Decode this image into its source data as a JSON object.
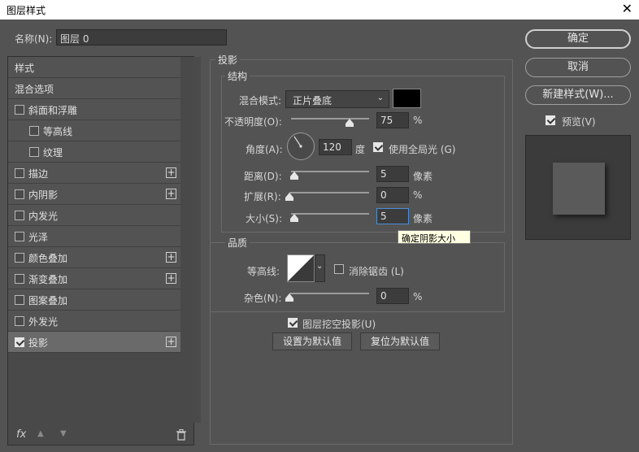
{
  "window": {
    "title": "图层样式",
    "close": "✕"
  },
  "name_field": {
    "label": "名称(N):",
    "value": "图层 0"
  },
  "style_list": {
    "items": [
      {
        "label": "样式",
        "checkbox": false,
        "checked": false,
        "plus": false,
        "indent": 0
      },
      {
        "label": "混合选项",
        "checkbox": false,
        "checked": false,
        "plus": false,
        "indent": 0
      },
      {
        "label": "斜面和浮雕",
        "checkbox": true,
        "checked": false,
        "plus": false,
        "indent": 0
      },
      {
        "label": "等高线",
        "checkbox": true,
        "checked": false,
        "plus": false,
        "indent": 1
      },
      {
        "label": "纹理",
        "checkbox": true,
        "checked": false,
        "plus": false,
        "indent": 1
      },
      {
        "label": "描边",
        "checkbox": true,
        "checked": false,
        "plus": true,
        "indent": 0
      },
      {
        "label": "内阴影",
        "checkbox": true,
        "checked": false,
        "plus": true,
        "indent": 0
      },
      {
        "label": "内发光",
        "checkbox": true,
        "checked": false,
        "plus": false,
        "indent": 0
      },
      {
        "label": "光泽",
        "checkbox": true,
        "checked": false,
        "plus": false,
        "indent": 0
      },
      {
        "label": "颜色叠加",
        "checkbox": true,
        "checked": false,
        "plus": true,
        "indent": 0
      },
      {
        "label": "渐变叠加",
        "checkbox": true,
        "checked": false,
        "plus": true,
        "indent": 0
      },
      {
        "label": "图案叠加",
        "checkbox": true,
        "checked": false,
        "plus": false,
        "indent": 0
      },
      {
        "label": "外发光",
        "checkbox": true,
        "checked": false,
        "plus": false,
        "indent": 0
      },
      {
        "label": "投影",
        "checkbox": true,
        "checked": true,
        "plus": true,
        "indent": 0,
        "selected": true
      }
    ],
    "plus_symbol": "+",
    "fx_label": "fx",
    "up_icon": "▲",
    "down_icon": "▼",
    "trash_icon": "🗑"
  },
  "drop_shadow": {
    "section_title": "投影",
    "structure": {
      "title": "结构",
      "blend_mode_label": "混合模式:",
      "blend_mode_value": "正片叠底",
      "shadow_color": "#000000",
      "opacity_label": "不透明度(O):",
      "opacity_value": "75",
      "opacity_unit": "%",
      "opacity_level": 0.75,
      "angle_label": "角度(A):",
      "angle_value": "120",
      "angle_unit": "度",
      "global_light_label": "使用全局光 (G)",
      "global_light_checked": true,
      "distance_label": "距离(D):",
      "distance_value": "5",
      "distance_unit": "像素",
      "spread_label": "扩展(R):",
      "spread_value": "0",
      "spread_unit": "%",
      "size_label": "大小(S):",
      "size_value": "5",
      "size_unit": "像素"
    },
    "quality": {
      "title": "品质",
      "contour_label": "等高线:",
      "anti_alias_label": "消除锯齿 (L)",
      "noise_label": "杂色(N):",
      "noise_value": "0",
      "noise_unit": "%"
    },
    "knockout_label": "图层挖空投影(U)",
    "knockout_checked": true,
    "make_default": "设置为默认值",
    "reset_default": "复位为默认值"
  },
  "tooltip": "确定阴影大小",
  "buttons": {
    "ok": "确定",
    "cancel": "取消",
    "new_style": "新建样式(W)...",
    "preview_label": "预览(V)",
    "preview_checked": true
  }
}
